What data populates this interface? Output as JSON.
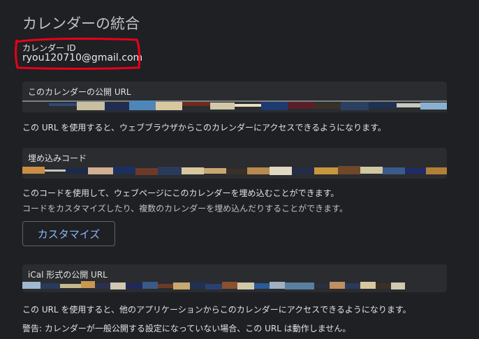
{
  "page": {
    "title": "カレンダーの統合"
  },
  "calendar_id": {
    "label": "カレンダー ID",
    "value": "ryou120710@gmail.com"
  },
  "public_url": {
    "label": "このカレンダーの公開 URL",
    "description": "この URL を使用すると、ウェブブラウザからこのカレンダーにアクセスできるようになります。"
  },
  "embed_code": {
    "label": "埋め込みコード",
    "description": "このコードを使用して、ウェブページにこのカレンダーを埋め込むことができます。",
    "sub_description": "コードをカスタマイズしたり、複数のカレンダーを埋め込んだりすることができます。",
    "customize_button": "カスタマイズ"
  },
  "ical_url": {
    "label": "iCal 形式の公開 URL",
    "description": "この URL を使用すると、他のアプリケーションからこのカレンダーにアクセスできるようになります。",
    "warning": "警告: カレンダーが一般公開する設定になっていない場合、この URL は動作しません。"
  },
  "colors": {
    "background": "#1f2023",
    "field_bg": "#2a2c2f",
    "accent": "#8ab4f8",
    "annotation": "#e8001c"
  }
}
